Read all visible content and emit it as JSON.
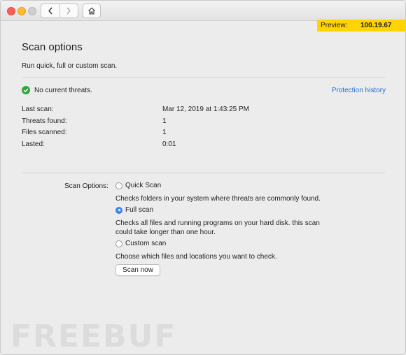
{
  "titlebar": {
    "back_icon": "chevron-left-icon",
    "forward_icon": "chevron-right-icon",
    "home_icon": "home-icon"
  },
  "preview_badge": {
    "label": "Preview:",
    "version": "100.19.67",
    "color": "#ffd400"
  },
  "header": {
    "title": "Scan options",
    "subtitle": "Run quick, full or custom scan."
  },
  "status": {
    "icon": "green-check-icon",
    "text": "No current threats.",
    "link": "Protection history",
    "accent": "#1d6fd8"
  },
  "details": [
    {
      "label": "Last scan:",
      "value": "Mar 12, 2019 at 1:43:25 PM"
    },
    {
      "label": "Threats found:",
      "value": "1"
    },
    {
      "label": "Files scanned:",
      "value": "1"
    },
    {
      "label": "Lasted:",
      "value": "0:01"
    }
  ],
  "scan_options": {
    "label": "Scan Options:",
    "options": [
      {
        "label": "Quick Scan",
        "selected": false,
        "description": "Checks folders in your system where threats are commonly found."
      },
      {
        "label": "Full scan",
        "selected": true,
        "description": "Checks all files and running programs on your hard disk. this scan could take longer than one hour."
      },
      {
        "label": "Custom scan",
        "selected": false,
        "description": "Choose which files and locations you want to check."
      }
    ],
    "button": "Scan now"
  },
  "watermark": "FREEBUF"
}
